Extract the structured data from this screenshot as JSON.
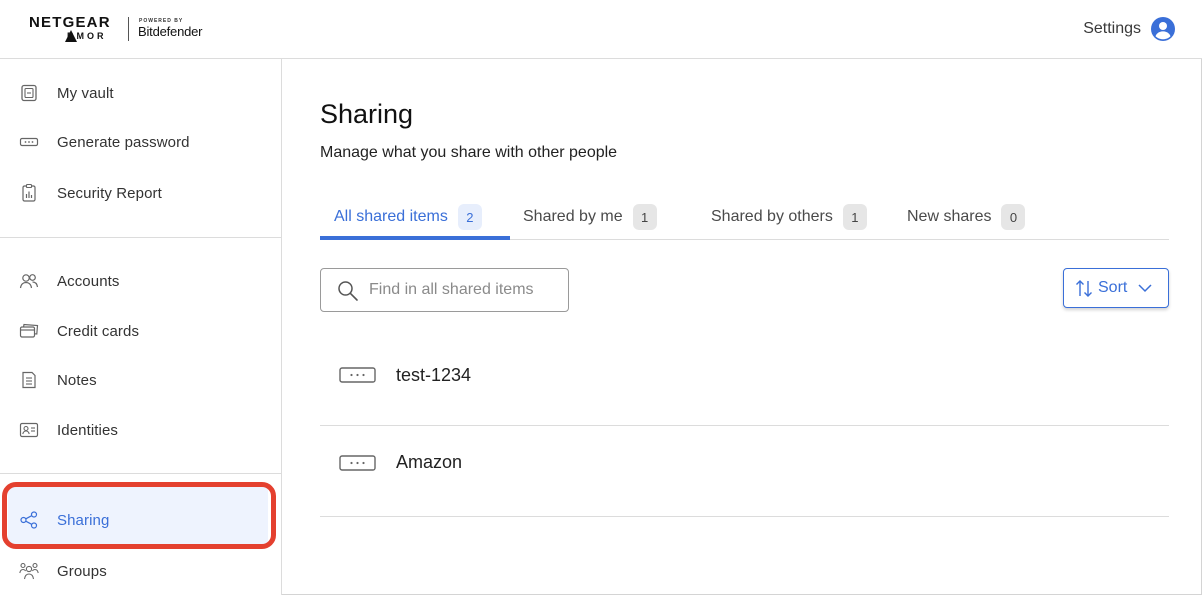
{
  "header": {
    "brand_main": "NETGEAR",
    "brand_armor": "RMOR",
    "brand_powered": "POWERED BY",
    "brand_partner": "Bitdefender",
    "settings_label": "Settings"
  },
  "sidebar": {
    "groups": [
      [
        {
          "label": "My vault",
          "icon": "vault-icon"
        },
        {
          "label": "Generate password",
          "icon": "password-icon"
        },
        {
          "label": "Security Report",
          "icon": "report-icon"
        }
      ],
      [
        {
          "label": "Accounts",
          "icon": "accounts-icon"
        },
        {
          "label": "Credit cards",
          "icon": "credit-card-icon"
        },
        {
          "label": "Notes",
          "icon": "notes-icon"
        },
        {
          "label": "Identities",
          "icon": "identity-icon"
        }
      ],
      [
        {
          "label": "Sharing",
          "icon": "sharing-icon",
          "active": true
        },
        {
          "label": "Groups",
          "icon": "groups-icon"
        }
      ]
    ]
  },
  "main": {
    "title": "Sharing",
    "subtitle": "Manage what you share with other people",
    "tabs": [
      {
        "label": "All shared items",
        "count": "2",
        "active": true
      },
      {
        "label": "Shared by me",
        "count": "1"
      },
      {
        "label": "Shared by others",
        "count": "1"
      },
      {
        "label": "New shares",
        "count": "0"
      }
    ],
    "search": {
      "placeholder": "Find in all shared items",
      "value": ""
    },
    "sort_label": "Sort",
    "items": [
      {
        "label": "test-1234",
        "icon": "password-field-icon"
      },
      {
        "label": "Amazon",
        "icon": "password-field-icon"
      }
    ]
  },
  "colors": {
    "accent": "#3a6fd8",
    "highlight_ring": "#e4402f",
    "active_bg": "#eef3fe"
  }
}
